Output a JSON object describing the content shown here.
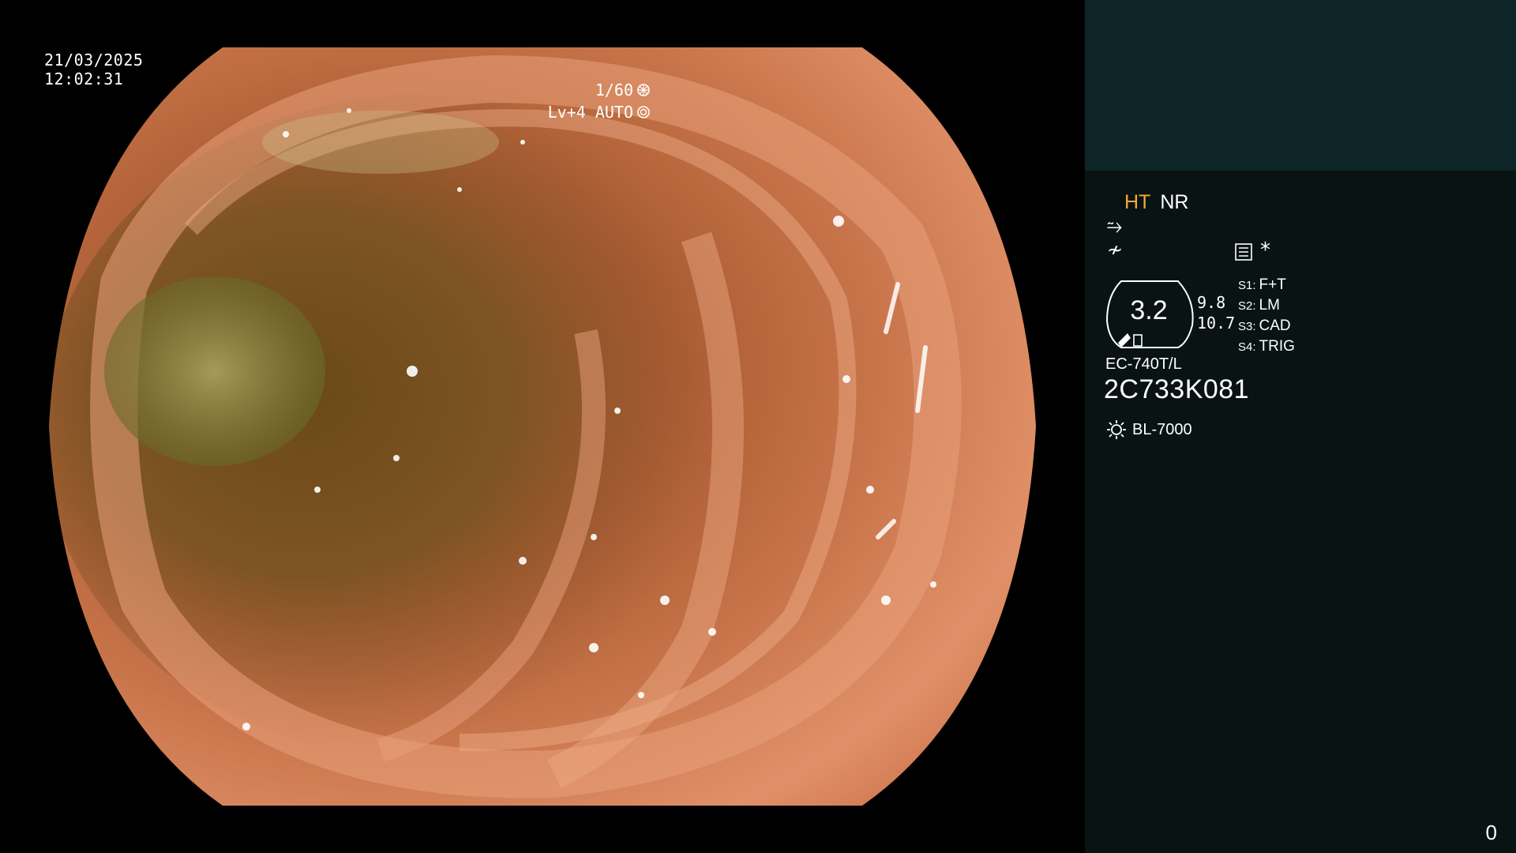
{
  "overlay": {
    "date": "21/03/2025",
    "time": "12:02:31",
    "shutter": "1/60",
    "level": "Lv+4 AUTO",
    "shutter_icon": "aperture-icon",
    "auto_icon": "iris-icon"
  },
  "panel": {
    "ht": "HT",
    "nr": "NR",
    "glyph_1": "⥲",
    "glyph_2": "≁",
    "menu_icon": "settings-list-icon",
    "star": "*",
    "zoom_value": "3.2",
    "values": [
      "9.8",
      "10.7"
    ],
    "switches": [
      {
        "key": "S1:",
        "value": "F+T"
      },
      {
        "key": "S2:",
        "value": "LM"
      },
      {
        "key": "S3:",
        "value": "CAD"
      },
      {
        "key": "S4:",
        "value": "TRIG"
      }
    ],
    "scope_model": "EC-740T/L",
    "serial": "2C733K081",
    "light_icon": "light-source-icon",
    "light_source": "BL-7000",
    "counter": "0",
    "accent_color": "#f3a93a"
  }
}
